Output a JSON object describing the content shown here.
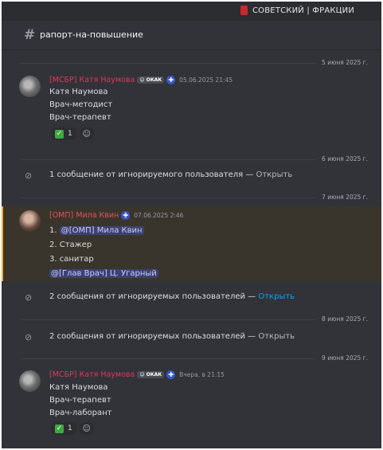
{
  "server": {
    "name": "СОВЕТСКИЙ | ФРАКЦИИ"
  },
  "channel": {
    "hash": "#",
    "name": "рапорт-на-повышение"
  },
  "dividers": [
    "5 июня 2025 г.",
    "6 июня 2025 г.",
    "7 июня 2025 г.",
    "8 июня 2025 г.",
    "9 июня 2025 г."
  ],
  "messages": [
    {
      "author": "[МСБР] Катя Наумова",
      "tag": "ОКАК",
      "med_icon": "✚",
      "time": "05.06.2025 21:45",
      "lines": [
        "Катя Наумова",
        "Врач-методист",
        "Врач-терапевт"
      ],
      "reaction": {
        "emoji": "✓",
        "count": "1"
      }
    },
    {
      "author": "[ОМП] Мила Квин",
      "med_icon": "✚",
      "time": "07.06.2025 2:46",
      "lines": [
        "1. ",
        "2. Стажер",
        "3. санитар"
      ],
      "mention1": "@[ОМП] Мила Квин",
      "mention2": "@[Глав Врач] Ц. Угарный"
    },
    {
      "author": "[МСБР] Катя Наумова",
      "tag": "ОКАК",
      "med_icon": "✚",
      "time": "Вчера, в 21:15",
      "lines": [
        "Катя Наумова",
        "Врач-терапевт",
        "Врач-лаборант"
      ],
      "reaction": {
        "emoji": "✓",
        "count": "1"
      }
    }
  ],
  "ignored": [
    {
      "text": "1 сообщение от игнорируемого пользователя — ",
      "link": "Открыть"
    },
    {
      "text": "2 сообщения от игнорируемых пользователей — ",
      "link": "Открыть"
    },
    {
      "text": "2 сообщения от игнорируемых пользователей — ",
      "link": "Открыть"
    }
  ],
  "icons": {
    "hash": "hash-icon",
    "eye_slash": "eye-slash-icon",
    "add_reaction": "add-reaction-icon"
  }
}
